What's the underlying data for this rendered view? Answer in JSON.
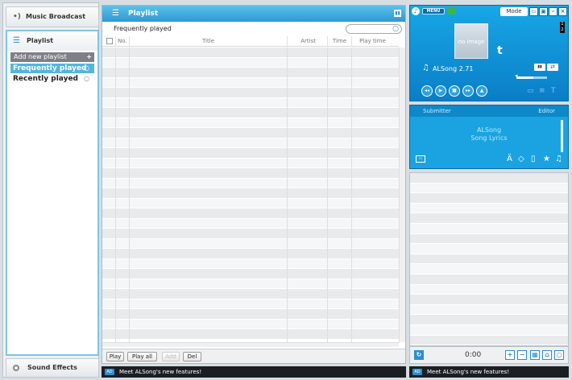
{
  "left_panel": {
    "broadcast_label": "Music Broadcast",
    "playlist_label": "Playlist",
    "add_playlist_label": "Add new playlist",
    "playlists": [
      {
        "label": "Frequently played",
        "selected": true
      },
      {
        "label": "Recently played",
        "selected": false
      }
    ],
    "sound_effects_label": "Sound Effects"
  },
  "middle_panel": {
    "title": "Playlist",
    "current_playlist": "Frequently played",
    "search": {
      "value": "",
      "placeholder": ""
    },
    "columns": [
      "No.",
      "Title",
      "Artist",
      "Time",
      "Play time"
    ],
    "rows": [],
    "buttons": {
      "play": "Play",
      "play_all": "Play all",
      "add": "Add",
      "del": "Del"
    },
    "ad_badge": "AD",
    "ad_text": "Meet ALSong's new features!"
  },
  "player": {
    "menu_label": "MENU",
    "mode_label": "Mode",
    "album_art_text": "no image",
    "song_title": "ALSong 2.71",
    "volume_fraction": 0.55,
    "indicator_text": "1 2"
  },
  "lyrics": {
    "submitter_label": "Submitter",
    "editor_label": "Editor",
    "line1": "ALSong",
    "line2": "Song Lyrics"
  },
  "queue": {
    "time": "0:00",
    "ad_badge": "AD",
    "ad_text": "Meet ALSong's new features!"
  },
  "colors": {
    "accent": "#2f98d2",
    "selected_row": "#56b4dd",
    "player_bg": "#0a7ec7"
  }
}
